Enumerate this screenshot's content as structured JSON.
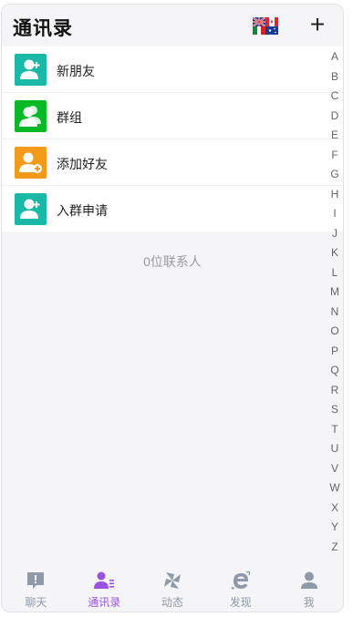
{
  "header": {
    "title": "通讯录",
    "add_label": "+"
  },
  "menu": [
    {
      "label": "新朋友",
      "icon": "new-friend-icon",
      "color": "#1ab8a6"
    },
    {
      "label": "群组",
      "icon": "group-icon",
      "color": "#08b927"
    },
    {
      "label": "添加好友",
      "icon": "add-friend-icon",
      "color": "#f29a19"
    },
    {
      "label": "入群申请",
      "icon": "group-request-icon",
      "color": "#1ab8a6"
    }
  ],
  "contact_count": "0位联系人",
  "alphabet": [
    "A",
    "B",
    "C",
    "D",
    "E",
    "F",
    "G",
    "H",
    "I",
    "J",
    "K",
    "L",
    "M",
    "N",
    "O",
    "P",
    "Q",
    "R",
    "S",
    "T",
    "U",
    "V",
    "W",
    "X",
    "Y",
    "Z"
  ],
  "tabs": [
    {
      "label": "聊天",
      "icon": "chat-icon"
    },
    {
      "label": "通讯录",
      "icon": "contacts-icon",
      "active": true
    },
    {
      "label": "动态",
      "icon": "moments-icon"
    },
    {
      "label": "发现",
      "icon": "discover-icon"
    },
    {
      "label": "我",
      "icon": "me-icon"
    }
  ],
  "colors": {
    "accent": "#9c52e0",
    "tab_inactive": "#8e9aaa",
    "background": "#f5f5f7"
  }
}
